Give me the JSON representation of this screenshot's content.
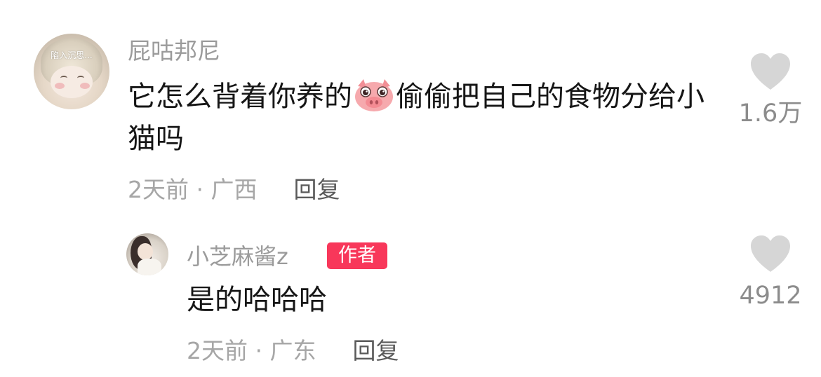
{
  "comment": {
    "avatar_caption": "陷入沉思...",
    "username": "屁咕邦尼",
    "content_before_emoji": "它怎么背着你养的",
    "emoji": "pig-face-emoji",
    "content_after_emoji": "偷偷把自己的食物分给小猫吗",
    "time": "2天前",
    "separator": " · ",
    "location": "广西",
    "reply_label": "回复",
    "likes": "1.6万"
  },
  "reply": {
    "username": "小芝麻酱z",
    "badge": "作者",
    "content": "是的哈哈哈",
    "time": "2天前",
    "separator": " · ",
    "location": "广东",
    "reply_label": "回复",
    "likes": "4912"
  },
  "colors": {
    "username": "#9b9b9b",
    "content": "#161616",
    "meta": "#a6a6a6",
    "reply_action": "#5a5a5a",
    "heart": "#d6d6d6",
    "badge": "#f8375a"
  }
}
